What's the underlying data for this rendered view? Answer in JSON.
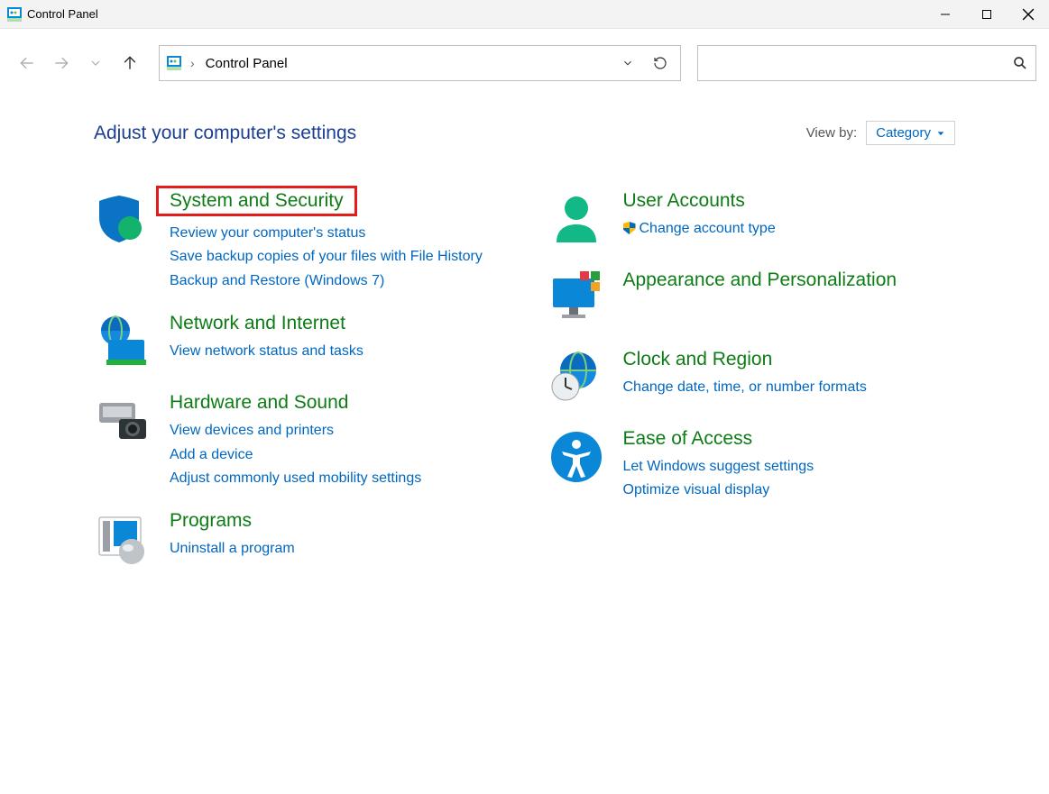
{
  "window": {
    "title": "Control Panel"
  },
  "breadcrumb": {
    "root": "Control Panel"
  },
  "viewby": {
    "label": "View by:",
    "value": "Category"
  },
  "page": {
    "heading": "Adjust your computer's settings"
  },
  "cats": {
    "system": {
      "title": "System and Security",
      "links": [
        "Review your computer's status",
        "Save backup copies of your files with File History",
        "Backup and Restore (Windows 7)"
      ]
    },
    "network": {
      "title": "Network and Internet",
      "links": [
        "View network status and tasks"
      ]
    },
    "hardware": {
      "title": "Hardware and Sound",
      "links": [
        "View devices and printers",
        "Add a device",
        "Adjust commonly used mobility settings"
      ]
    },
    "programs": {
      "title": "Programs",
      "links": [
        "Uninstall a program"
      ]
    },
    "users": {
      "title": "User Accounts",
      "links": [
        "Change account type"
      ]
    },
    "appearance": {
      "title": "Appearance and Personalization",
      "links": []
    },
    "clock": {
      "title": "Clock and Region",
      "links": [
        "Change date, time, or number formats"
      ]
    },
    "ease": {
      "title": "Ease of Access",
      "links": [
        "Let Windows suggest settings",
        "Optimize visual display"
      ]
    }
  }
}
